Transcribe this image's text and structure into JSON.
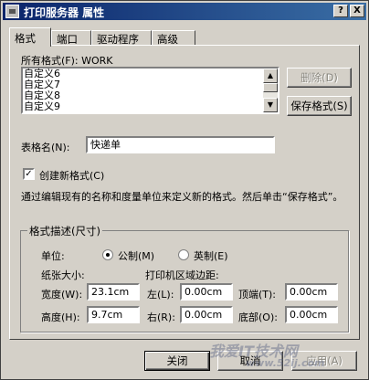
{
  "window": {
    "title": "打印服务器 属性",
    "help_btn": "?",
    "close_btn": "X"
  },
  "tabs": [
    "格式",
    "端口",
    "驱动程序",
    "高级"
  ],
  "forms": {
    "label": "所有格式(F): WORK",
    "items": [
      "自定义6",
      "自定义7",
      "自定义8",
      "自定义9"
    ],
    "delete_btn": "删除(D)",
    "save_btn": "保存格式(S)"
  },
  "form_name": {
    "label": "表格名(N):",
    "value": "快递单"
  },
  "create_new": {
    "label": "创建新格式(C)",
    "checked": true,
    "mark": "✓"
  },
  "description": "通过编辑现有的名称和度量单位来定义新的格式。然后单击“保存格式”。",
  "group": {
    "label": "格式描述(尺寸)",
    "unit_label": "单位:",
    "metric": "公制(M)",
    "english": "英制(E)",
    "paper_size": "纸张大小:",
    "margins": "打印机区域边距:",
    "width_label": "宽度(W):",
    "width_value": "23.1cm",
    "height_label": "高度(H):",
    "height_value": "9.7cm",
    "left_label": "左(L):",
    "left_value": "0.00cm",
    "right_label": "右(R):",
    "right_value": "0.00cm",
    "top_label": "顶端(T):",
    "top_value": "0.00cm",
    "bottom_label": "底部(O):",
    "bottom_value": "0.00cm"
  },
  "footer": {
    "close": "关闭",
    "cancel": "取消",
    "apply": "应用(A)"
  },
  "watermark": {
    "text": "我爱IT技术网",
    "sub": "www.52ij.com"
  }
}
